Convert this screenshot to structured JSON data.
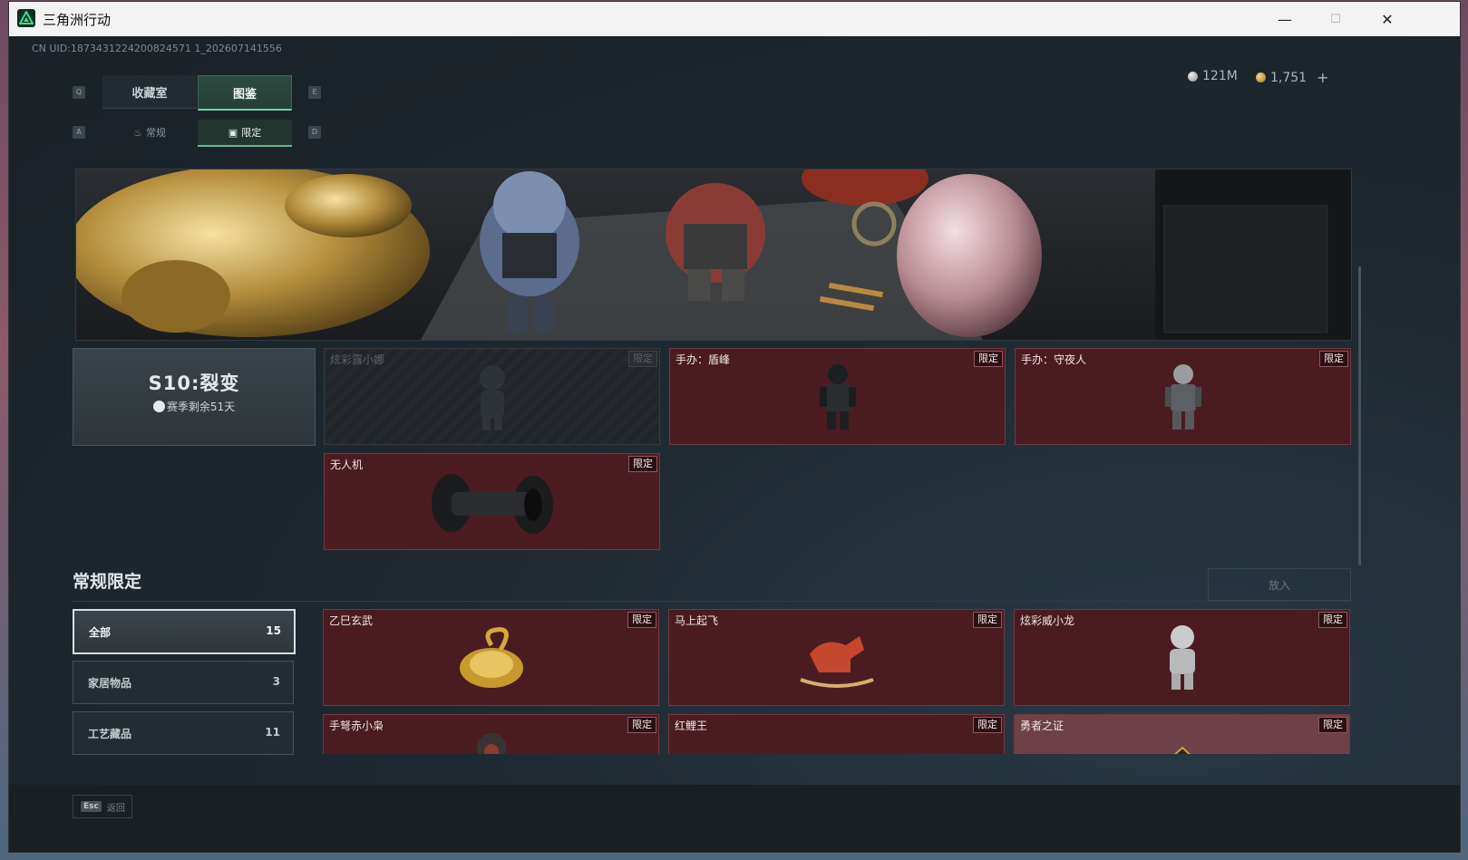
{
  "window": {
    "title": "三角洲行动",
    "minimize": "—",
    "maximize": "☐",
    "close": "✕"
  },
  "uid": "CN UID:1873431224200824571 1_202607141556",
  "currency": [
    {
      "value": "121M",
      "color": "#c9c9c9"
    },
    {
      "value": "1,751",
      "color": "#d8b15a",
      "plus": "+"
    }
  ],
  "tabs": {
    "left_key": "Q",
    "right_key": "E",
    "items": [
      {
        "label": "收藏室",
        "active": false
      },
      {
        "label": "图鉴",
        "active": true
      }
    ]
  },
  "subtabs": {
    "left_key": "A",
    "right_key": "D",
    "items": [
      {
        "label": "常规",
        "icon": "flame-icon",
        "active": false
      },
      {
        "label": "限定",
        "icon": "image-icon",
        "active": true
      }
    ]
  },
  "season": {
    "name": "S10:裂变",
    "remaining": "赛季剩余51天",
    "icon": "clock-icon"
  },
  "season_cards": [
    {
      "name": "炫彩露小娜",
      "badge": "限定",
      "locked": true
    },
    {
      "name": "手办：盾峰",
      "badge": "限定",
      "locked": false
    },
    {
      "name": "手办：守夜人",
      "badge": "限定",
      "locked": false
    },
    {
      "name": "无人机",
      "badge": "限定",
      "locked": false
    }
  ],
  "section": {
    "title": "常规限定",
    "put_in": "放入"
  },
  "filters": [
    {
      "label": "全部",
      "count": "15",
      "active": true
    },
    {
      "label": "家居物品",
      "count": "3",
      "active": false
    },
    {
      "label": "工艺藏品",
      "count": "11",
      "active": false
    }
  ],
  "items": [
    {
      "name": "乙巳玄武",
      "badge": "限定"
    },
    {
      "name": "马上起飞",
      "badge": "限定"
    },
    {
      "name": "炫彩威小龙",
      "badge": "限定"
    },
    {
      "name": "手弩赤小枭",
      "badge": "限定"
    },
    {
      "name": "红鲤王",
      "badge": "限定"
    },
    {
      "name": "勇者之证",
      "badge": "限定"
    }
  ],
  "footer": {
    "esc_key": "Esc",
    "back_label": "返回"
  }
}
